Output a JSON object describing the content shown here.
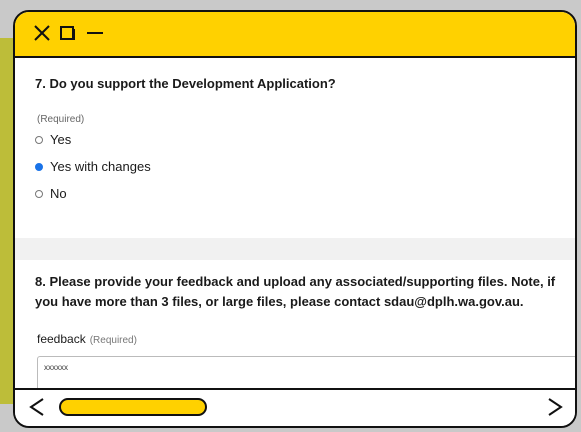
{
  "window": {
    "title_icons": [
      "close-icon",
      "maximize-icon",
      "minimize-icon"
    ]
  },
  "question7": {
    "title": "7. Do you support the Development Application?",
    "required": "(Required)",
    "options": [
      {
        "label": "Yes",
        "selected": false
      },
      {
        "label": "Yes with changes",
        "selected": true
      },
      {
        "label": "No",
        "selected": false
      }
    ]
  },
  "question8": {
    "title_line1": "8. Please provide your feedback and upload any associated/supporting files. Note, if",
    "title_line2": "you have more than 3 files, or large files, please contact sdau@dplh.wa.gov.au.",
    "field_label": "feedback",
    "field_required": "(Required)",
    "feedback_value": "xxxxxx"
  },
  "navigation": {
    "prev_icon": "chevron-left-icon",
    "next_icon": "chevron-right-icon"
  },
  "colors": {
    "accent": "#ffd100",
    "radio_selected": "#1a73e8"
  }
}
